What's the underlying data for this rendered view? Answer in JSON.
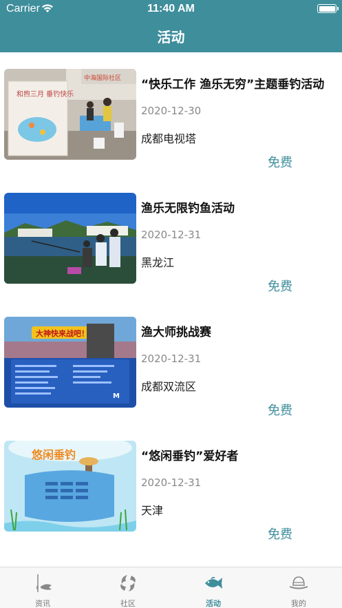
{
  "status_bar": {
    "carrier": "Carrier",
    "time": "11:40 AM"
  },
  "header": {
    "title": "活动"
  },
  "activities": [
    {
      "title": "“快乐工作 渔乐无穷”主题垂钓活动",
      "date": "2020-12-30",
      "location": "成都电视塔",
      "price": "免费",
      "thumb_text": "和煦三月 垂钓快乐",
      "thumb_sign": "中海国际社区"
    },
    {
      "title": "渔乐无限钓鱼活动",
      "date": "2020-12-31",
      "location": "黑龙江",
      "price": "免费"
    },
    {
      "title": "渔大师挑战赛",
      "date": "2020-12-31",
      "location": "成都双流区",
      "price": "免费",
      "thumb_text": "大神快来战吧！"
    },
    {
      "title": "“悠闲垂钓”爱好者",
      "date": "2020-12-31",
      "location": "天津",
      "price": "免费",
      "thumb_text": "悠闲垂钓"
    }
  ],
  "tabbar": {
    "items": [
      {
        "label": "资讯",
        "icon": "fishing-rod-icon"
      },
      {
        "label": "社区",
        "icon": "fish-pair-icon"
      },
      {
        "label": "活动",
        "icon": "fish-icon",
        "active": true
      },
      {
        "label": "我的",
        "icon": "hat-icon"
      }
    ]
  },
  "colors": {
    "brand": "#3f8e9c",
    "tab_inactive": "#777777"
  }
}
